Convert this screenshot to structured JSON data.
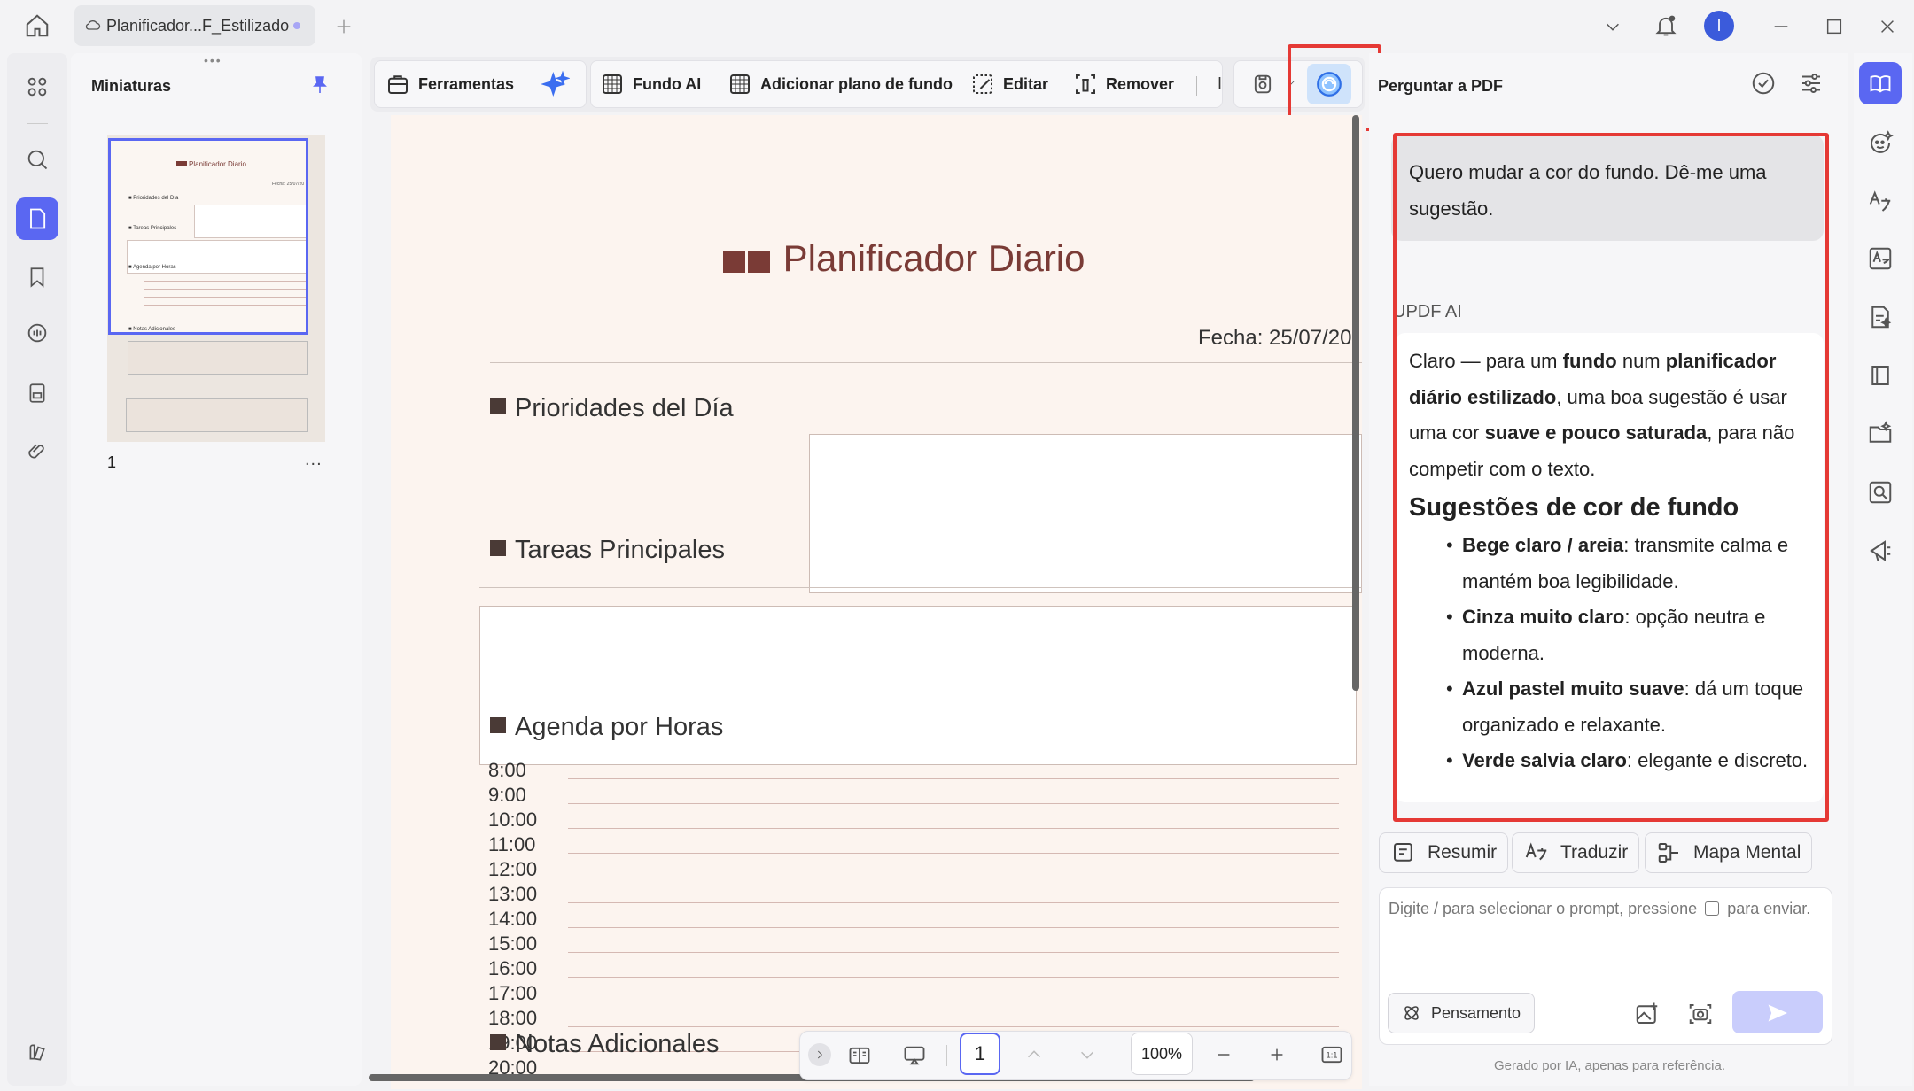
{
  "window": {
    "tab_title": "Planificador...F_Estilizado",
    "avatar_letter": "I"
  },
  "thumbnails": {
    "title": "Miniaturas",
    "page_number": "1",
    "more": "..."
  },
  "toolbar": {
    "tools": "Ferramentas",
    "ai_background": "Fundo AI",
    "add_background": "Adicionar plano de fundo",
    "edit": "Editar",
    "remove": "Remover",
    "truncated": "I"
  },
  "document": {
    "title": "Planificador Diario",
    "date": "Fecha: 25/07/20",
    "sections": {
      "priorities": "Prioridades del Día",
      "tasks": "Tareas Principales",
      "agenda": "Agenda por Horas",
      "notes": "Notas Adicionales"
    },
    "hours": [
      "8:00",
      "9:00",
      "10:00",
      "11:00",
      "12:00",
      "13:00",
      "14:00",
      "15:00",
      "16:00",
      "17:00",
      "18:00",
      "19:00",
      "20:00"
    ]
  },
  "thumbnail_preview": {
    "title": "Planificador Diario",
    "date": "Fecha: 25/07/20",
    "priorities": "Prioridades del Día",
    "tasks": "Tareas Principales",
    "agenda": "Agenda por Horas",
    "notes": "Notas Adicionales"
  },
  "navigation": {
    "page": "1",
    "zoom": "100%"
  },
  "ai_panel": {
    "title": "Perguntar a PDF",
    "user_message": "Quero mudar a cor do fundo. Dê-me uma sugestão.",
    "ai_label": "UPDF AI",
    "response": {
      "intro_1": "Claro — para um ",
      "intro_b1": "fundo",
      "intro_2": " num ",
      "intro_b2": "planificador diário estilizado",
      "intro_3": ", uma boa sugestão é usar uma cor ",
      "intro_b3": "suave e pouco saturada",
      "intro_4": ", para não competir com o texto.",
      "heading": "Sugestões de cor de fundo",
      "items": [
        {
          "bold": "Bege claro / areia",
          "text": ": transmite calma e mantém boa legibilidade."
        },
        {
          "bold": "Cinza muito claro",
          "text": ": opção neutra e moderna."
        },
        {
          "bold": "Azul pastel muito suave",
          "text": ": dá um toque organizado e relaxante."
        },
        {
          "bold": "Verde salvia claro",
          "text": ": elegante e discreto."
        }
      ]
    },
    "quick_actions": {
      "summarize": "Resumir",
      "translate": "Traduzir",
      "mind_map": "Mapa Mental"
    },
    "input_placeholder_1": "Digite / para selecionar o prompt, pressione",
    "input_placeholder_2": "para enviar.",
    "thinking": "Pensamento",
    "footnote": "Gerado por IA, apenas para referência."
  },
  "colors": {
    "accent": "#5a67f2",
    "highlight_red": "#e53935",
    "doc_title": "#7a3b36"
  }
}
